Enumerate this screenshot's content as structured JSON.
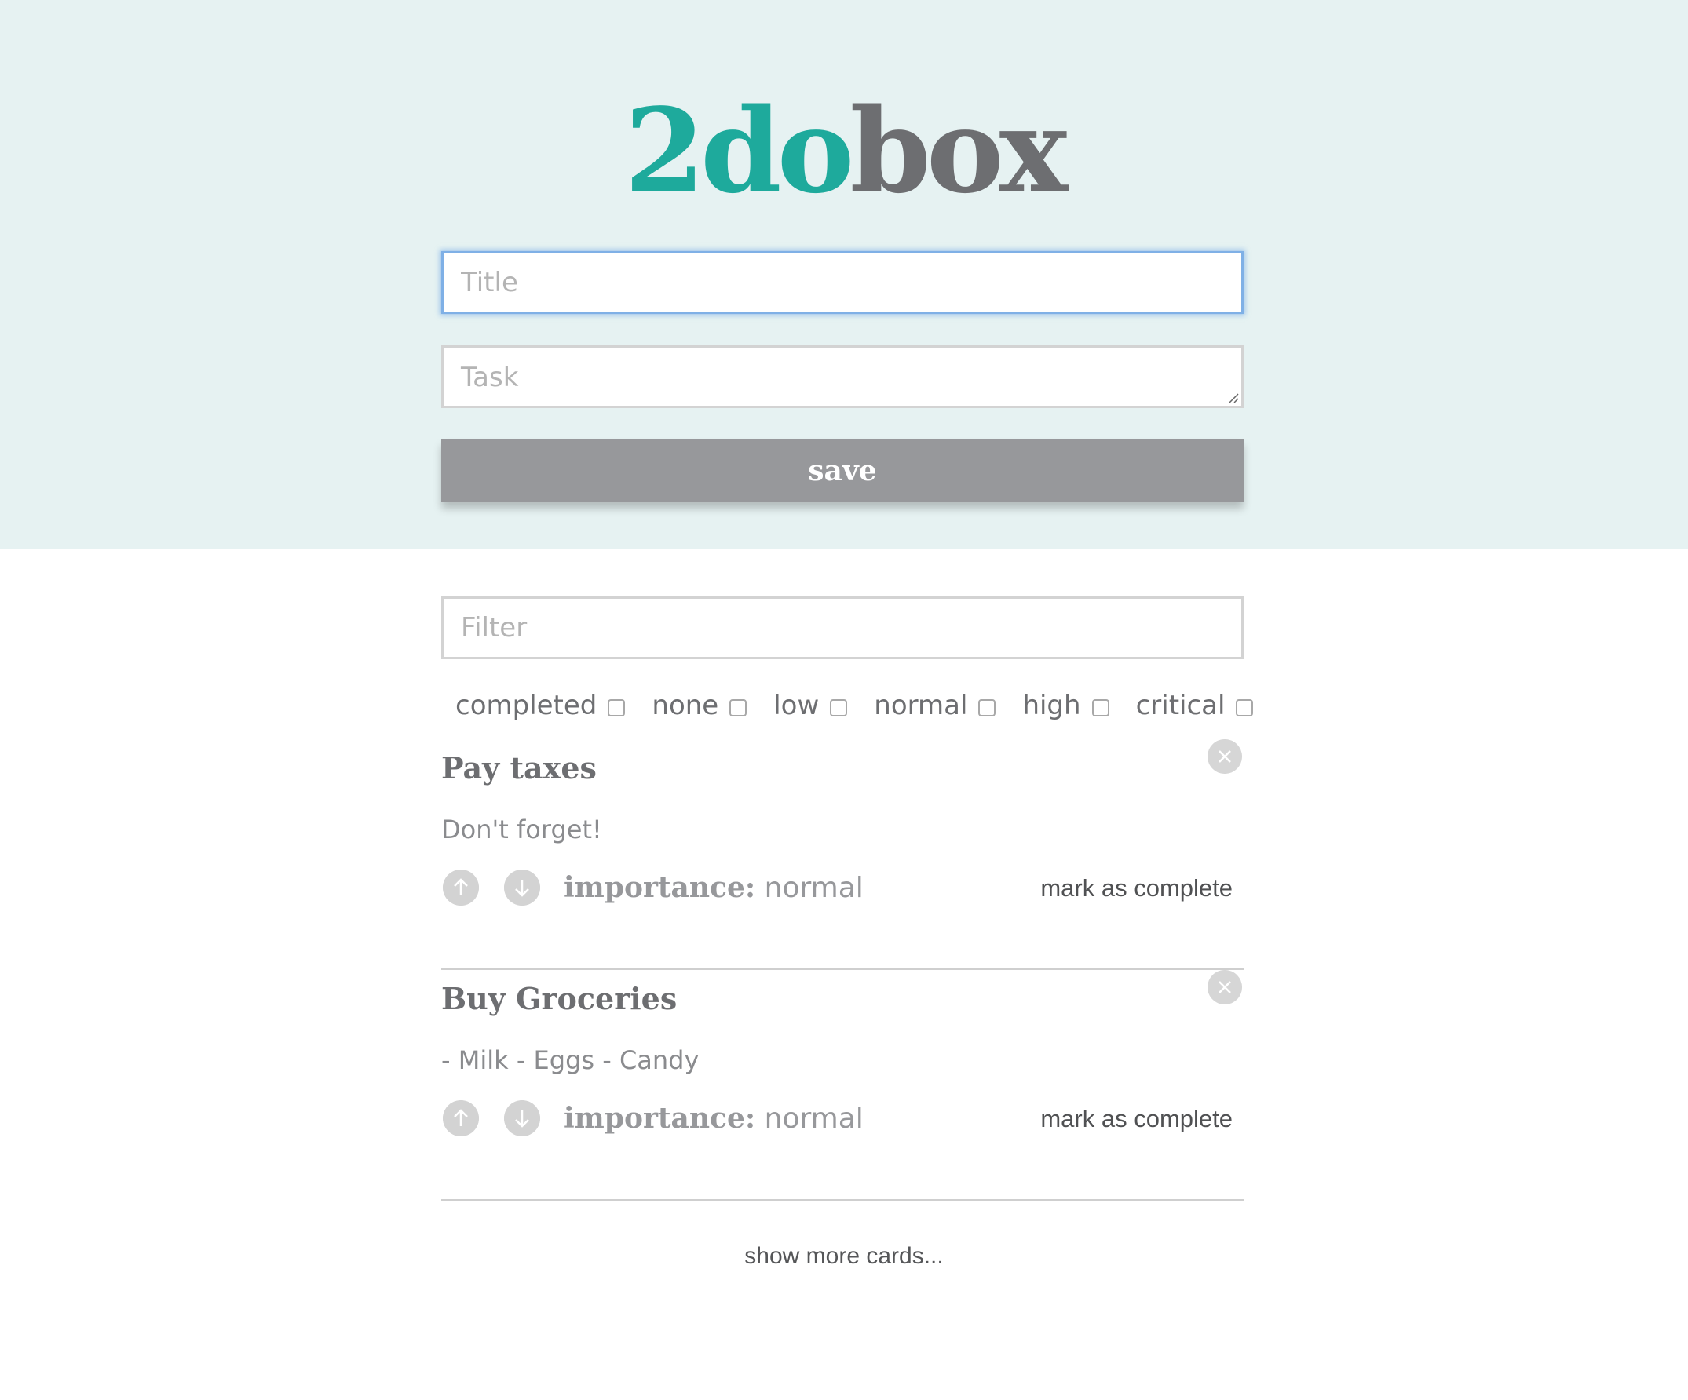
{
  "app": {
    "logo_part1": "2do",
    "logo_part2": "box",
    "logo_color_1": "#1eaa9c",
    "logo_color_2": "#6d6e71",
    "header_bg": "#e6f2f2"
  },
  "form": {
    "title_placeholder": "Title",
    "task_placeholder": "Task",
    "save_label": "save"
  },
  "filter": {
    "placeholder": "Filter",
    "checkboxes": [
      {
        "label": "completed",
        "checked": false
      },
      {
        "label": "none",
        "checked": false
      },
      {
        "label": "low",
        "checked": false
      },
      {
        "label": "normal",
        "checked": false
      },
      {
        "label": "high",
        "checked": false
      },
      {
        "label": "critical",
        "checked": false
      }
    ]
  },
  "cards": [
    {
      "title": "Pay taxes",
      "body": "Don't forget!",
      "importance_label": "importance:",
      "importance_value": "normal",
      "complete_label": "mark as complete",
      "icons": {
        "delete": "close-icon",
        "up": "arrow-up-icon",
        "down": "arrow-down-icon"
      }
    },
    {
      "title": "Buy Groceries",
      "body": "- Milk - Eggs - Candy",
      "importance_label": "importance:",
      "importance_value": "normal",
      "complete_label": "mark as complete",
      "icons": {
        "delete": "close-icon",
        "up": "arrow-up-icon",
        "down": "arrow-down-icon"
      }
    }
  ],
  "footer": {
    "show_more_label": "show more cards..."
  }
}
